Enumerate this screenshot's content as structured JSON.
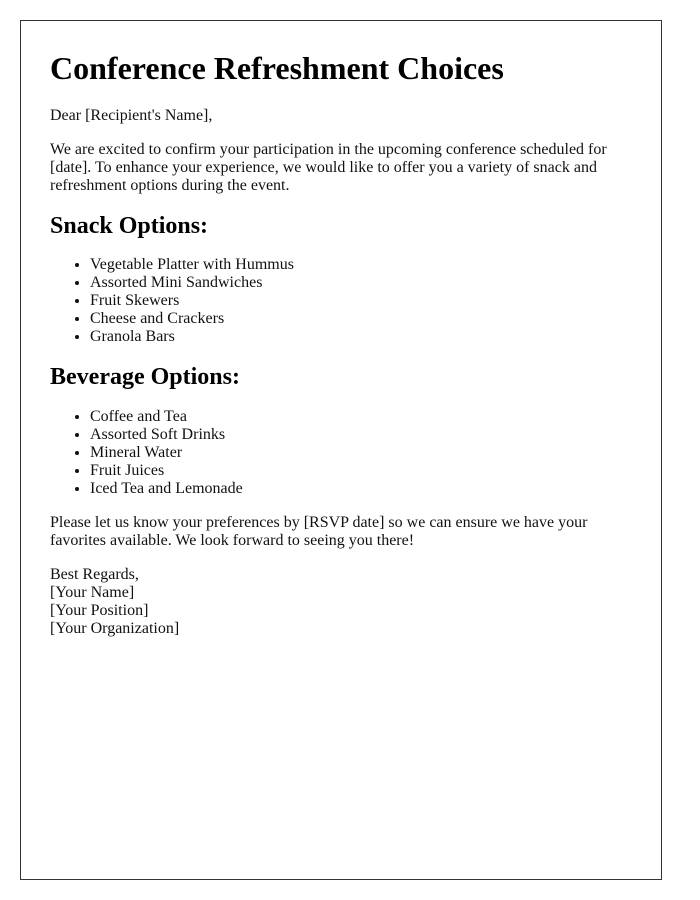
{
  "title": "Conference Refreshment Choices",
  "greeting": "Dear [Recipient's Name],",
  "intro": "We are excited to confirm your participation in the upcoming conference scheduled for [date]. To enhance your experience, we would like to offer you a variety of snack and refreshment options during the event.",
  "snacks": {
    "heading": "Snack Options:",
    "items": [
      "Vegetable Platter with Hummus",
      "Assorted Mini Sandwiches",
      "Fruit Skewers",
      "Cheese and Crackers",
      "Granola Bars"
    ]
  },
  "beverages": {
    "heading": "Beverage Options:",
    "items": [
      "Coffee and Tea",
      "Assorted Soft Drinks",
      "Mineral Water",
      "Fruit Juices",
      "Iced Tea and Lemonade"
    ]
  },
  "closing": "Please let us know your preferences by [RSVP date] so we can ensure we have your favorites available. We look forward to seeing you there!",
  "signature": {
    "sign_off": "Best Regards,",
    "name": "[Your Name]",
    "position": "[Your Position]",
    "organization": "[Your Organization]"
  }
}
